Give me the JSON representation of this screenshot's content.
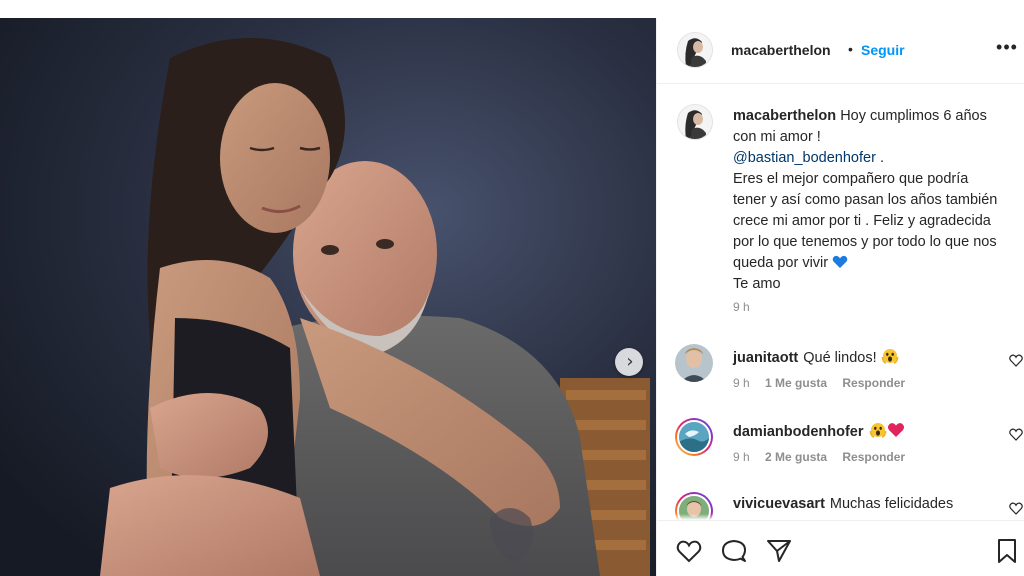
{
  "post": {
    "author": "macaberthelon",
    "separator": "•",
    "follow_label": "Seguir",
    "more_label": "•••",
    "next_label": "›"
  },
  "caption": {
    "username": "macaberthelon",
    "text_before_mention": "Hoy cumplimos 6 años con mi amor !",
    "mention": "@bastian_bodenhofer",
    "text_after_mention": " .\nEres el mejor compañero que podría tener y así como pasan los años también crece mi amor por ti . Feliz y agradecida por lo que tenemos y por todo lo que nos queda por vivir",
    "emoji": "blue-heart-icon",
    "text_end": "Te amo",
    "time": "9 h"
  },
  "comments": [
    {
      "username": "juanitaott",
      "text": "Qué lindos!",
      "emoji": "face-screaming-icon",
      "time": "9 h",
      "likes": "1 Me gusta",
      "reply": "Responder"
    },
    {
      "username": "damianbodenhofer",
      "text": "",
      "emoji": "face-screaming-and-red-heart-icons",
      "time": "9 h",
      "likes": "2 Me gusta",
      "reply": "Responder"
    },
    {
      "username": "vivicuevasart",
      "text": "Muchas felicidades",
      "emoji": "",
      "time": "",
      "likes": "",
      "reply": ""
    }
  ],
  "actions": [
    "like-icon",
    "comment-icon",
    "share-icon",
    "save-icon"
  ],
  "colors": {
    "link": "#0095f6",
    "mention": "#00376b",
    "muted": "#8e8e8e",
    "text": "#262626",
    "blue_heart": "#1d7be0",
    "red_heart": "#e0245e"
  }
}
